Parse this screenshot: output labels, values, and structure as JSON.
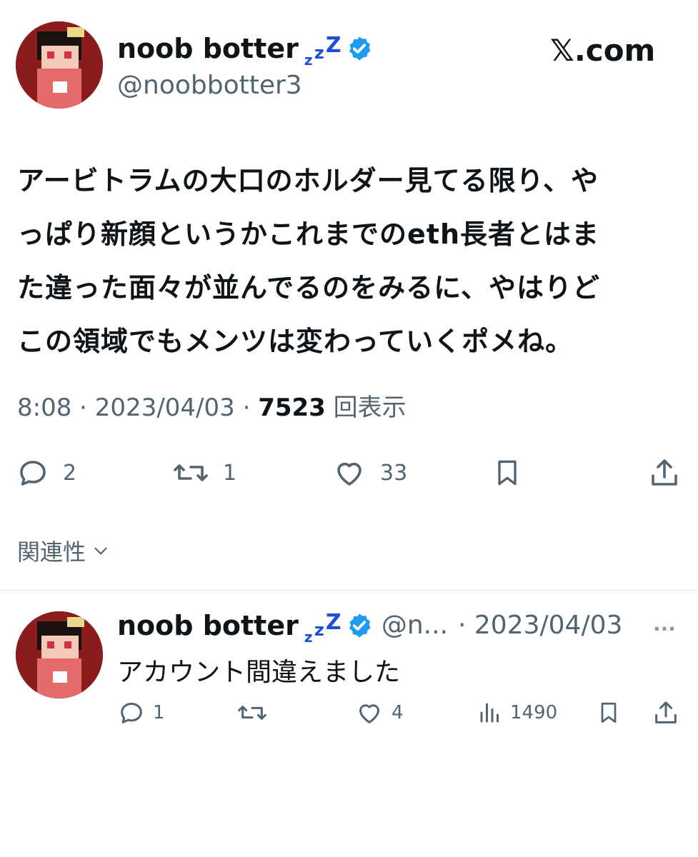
{
  "brand": "𝕏.com",
  "tweet": {
    "author": {
      "name": "noob botter",
      "zzz": "zzz",
      "handle": "@noobbotter3"
    },
    "text_lines": [
      "アービトラムの大口のホルダー見てる限り、や",
      "っぱり新顔というかこれまでのeth長者とはま",
      "た違った面々が並んでるのをみるに、やはりど",
      "この領域でもメンツは変わっていくポメね。"
    ],
    "time": "8:08",
    "date": "2023/04/03",
    "views_count": "7523",
    "views_label": "回表示",
    "sep": "·",
    "actions": {
      "replies": "2",
      "retweets": "1",
      "likes": "33"
    }
  },
  "relevance_label": "関連性",
  "reply": {
    "author": {
      "name": "noob botter",
      "zzz": "zzz",
      "handle": "@n...",
      "date": "· 2023/04/03"
    },
    "more": "···",
    "text": "アカウント間違えました",
    "actions": {
      "replies": "1",
      "retweets": "",
      "likes": "4",
      "views": "1490"
    }
  }
}
